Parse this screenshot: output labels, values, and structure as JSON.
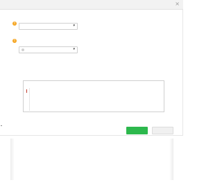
{
  "dialog": {
    "title": "",
    "close_label": "×"
  },
  "fields": {
    "account_label": "",
    "account_value": "",
    "caret": "▾",
    "info_glyph": "!",
    "method_label": "",
    "method_value": "",
    "domain_label": "",
    "domain_hint": "",
    "domain_placeholder": ""
  },
  "buttons": {
    "ok_label": "",
    "cancel_label": ""
  },
  "colors": {
    "primary": "#2db84d",
    "info": "#f5a623"
  }
}
